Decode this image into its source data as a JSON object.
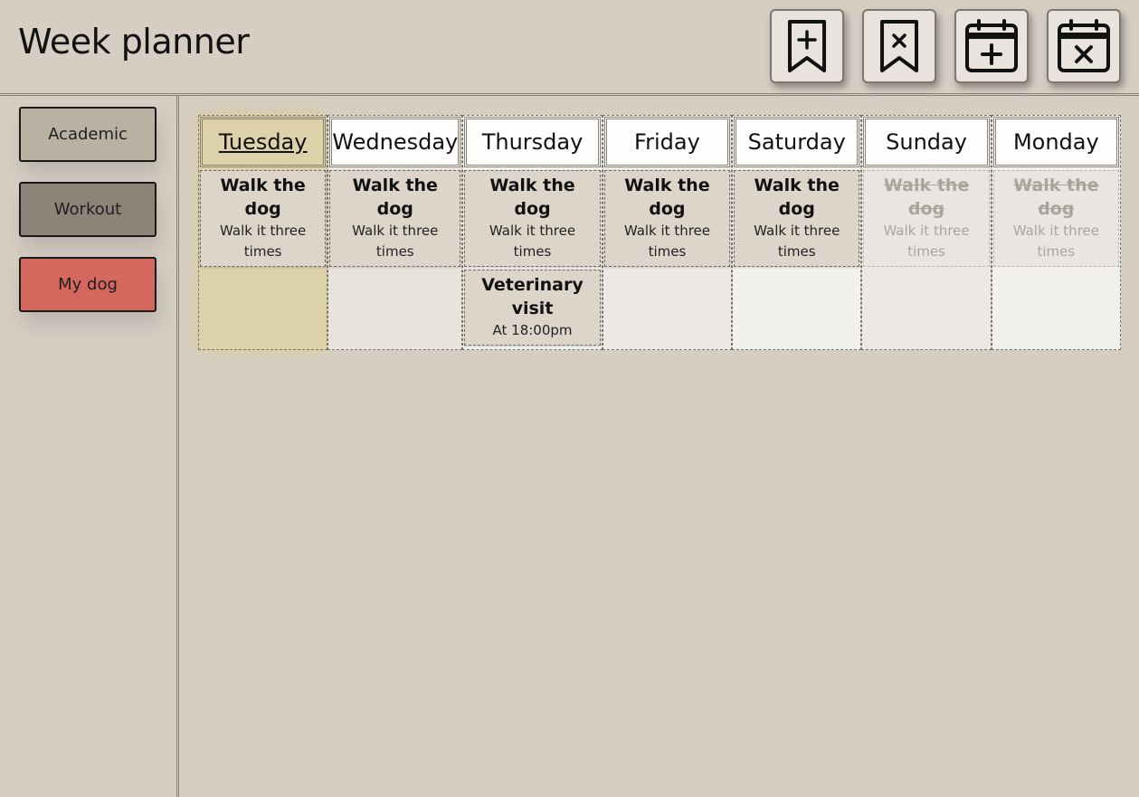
{
  "app": {
    "title": "Week planner"
  },
  "toolbar": [
    {
      "name": "add-bookmark-button",
      "icon": "bookmark-plus-icon"
    },
    {
      "name": "remove-bookmark-button",
      "icon": "bookmark-x-icon"
    },
    {
      "name": "add-event-button",
      "icon": "calendar-plus-icon"
    },
    {
      "name": "remove-event-button",
      "icon": "calendar-x-icon"
    }
  ],
  "categories": [
    {
      "label": "Academic",
      "color": "#b9b1a2"
    },
    {
      "label": "Workout",
      "color": "#8c8577"
    },
    {
      "label": "My dog",
      "color": "#d4675e"
    }
  ],
  "days": [
    {
      "name": "Tuesday",
      "today": true,
      "tasks": [
        {
          "title": "Walk the dog",
          "desc": "Walk it three times",
          "done": false
        }
      ]
    },
    {
      "name": "Wednesday",
      "tasks": [
        {
          "title": "Walk the dog",
          "desc": "Walk it three times",
          "done": false
        }
      ]
    },
    {
      "name": "Thursday",
      "tasks": [
        {
          "title": "Walk the dog",
          "desc": "Walk it three times",
          "done": false
        },
        {
          "title": "Veterinary visit",
          "desc": "At 18:00pm",
          "done": false
        }
      ]
    },
    {
      "name": "Friday",
      "tasks": [
        {
          "title": "Walk the dog",
          "desc": "Walk it three times",
          "done": false
        }
      ]
    },
    {
      "name": "Saturday",
      "tasks": [
        {
          "title": "Walk the dog",
          "desc": "Walk it three times",
          "done": false
        }
      ]
    },
    {
      "name": "Sunday",
      "tasks": [
        {
          "title": "Walk the dog",
          "desc": "Walk it three times",
          "done": true
        }
      ]
    },
    {
      "name": "Monday",
      "tasks": [
        {
          "title": "Walk the dog",
          "desc": "Walk it three times",
          "done": true
        }
      ]
    }
  ]
}
